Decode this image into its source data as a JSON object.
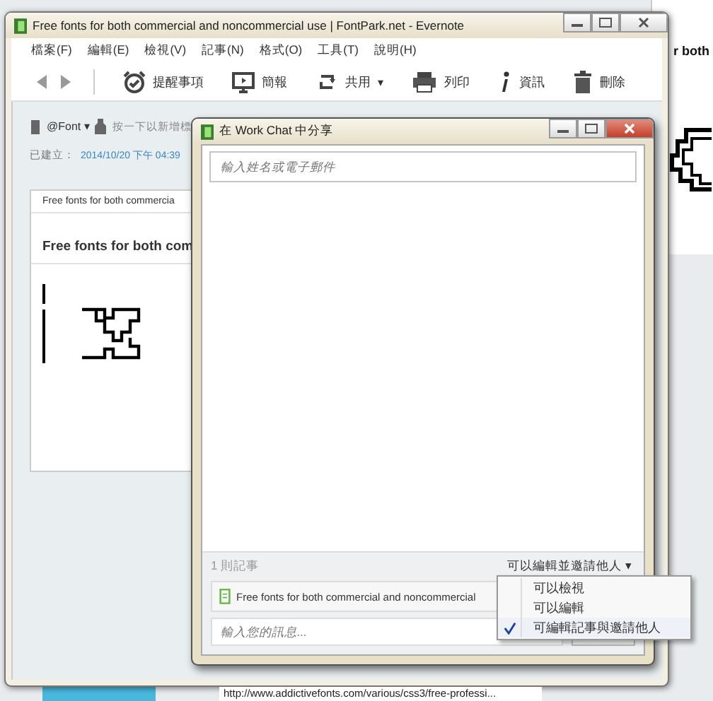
{
  "background_window": {
    "heading_fragment": "r both",
    "url": "http://www.addictivefonts.com/various/css3/free-professi..."
  },
  "main_window": {
    "title": "Free fonts for both commercial and noncommercial use | FontPark.net - Evernote",
    "menu": [
      "檔案(F)",
      "編輯(E)",
      "檢視(V)",
      "記事(N)",
      "格式(O)",
      "工具(T)",
      "說明(H)"
    ],
    "toolbar": [
      {
        "kind": "alarm",
        "label": "提醒事項"
      },
      {
        "kind": "present",
        "label": "簡報"
      },
      {
        "kind": "share",
        "label": "共用",
        "caret": "▾"
      },
      {
        "kind": "print",
        "label": "列印"
      },
      {
        "kind": "info",
        "label": "資訊"
      },
      {
        "kind": "trash",
        "label": "刪除"
      }
    ],
    "notebook": "@Font",
    "notebook_caret": "▾",
    "tag_placeholder": "按一下以新增標",
    "created_label": "已建立：",
    "created_value": "2014/10/20 下午 04:39",
    "note": {
      "source_title": "Free fonts for both commercia",
      "heading": "Free fonts for both com"
    }
  },
  "share_dialog": {
    "title": "在 Work Chat 中分享",
    "recipient_placeholder": "輸入姓名或電子郵件",
    "note_count": "1 則記事",
    "permission": "可以編輯並邀請他人",
    "permission_caret": "▾",
    "note_item": "Free fonts for both commercial and noncommercial",
    "message_placeholder": "輸入您的訊息..."
  },
  "permission_menu": [
    {
      "label": "可以檢視",
      "selected": false
    },
    {
      "label": "可以編輯",
      "selected": false
    },
    {
      "label": "可編輯記事與邀請他人",
      "selected": true
    }
  ]
}
